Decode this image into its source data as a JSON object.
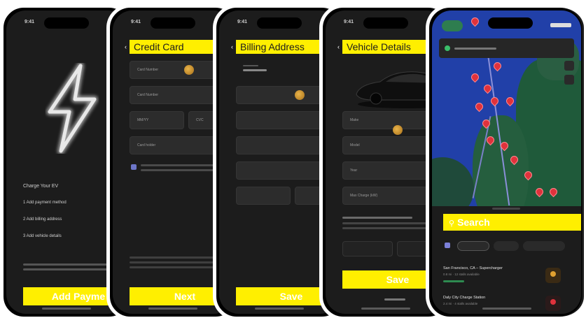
{
  "status": {
    "time": "9:41"
  },
  "screens": {
    "onboarding": {
      "heading": "Charge Your EV",
      "steps": [
        "1  Add payment method",
        "2  Add billing address",
        "3  Add vehicle details"
      ],
      "cta": "Add Payme"
    },
    "credit_card": {
      "title": "Credit Card",
      "fields": [
        "Card Number",
        "MM/YY",
        "CVC",
        "Card holder"
      ],
      "cta": "Next"
    },
    "billing_address": {
      "title": "Billing Address",
      "cta": "Save"
    },
    "vehicle_details": {
      "title": "Vehicle Details",
      "fields": [
        "Make",
        "Model",
        "Year",
        "Max Charge (kW)"
      ],
      "cta": "Save"
    },
    "map": {
      "search_label": "Search",
      "results": [
        {
          "title": "San Francisco, CA – Supercharger",
          "subtitle": "0.8 mi · 12 stalls available"
        },
        {
          "title": "Daly City Charge Station",
          "subtitle": "2.4 mi · 4 stalls available"
        }
      ]
    }
  },
  "colors": {
    "accent": "#ffef00",
    "screen_bg": "#1c1c1c",
    "pin": "#e0323c",
    "map_water": "#2140a8"
  }
}
